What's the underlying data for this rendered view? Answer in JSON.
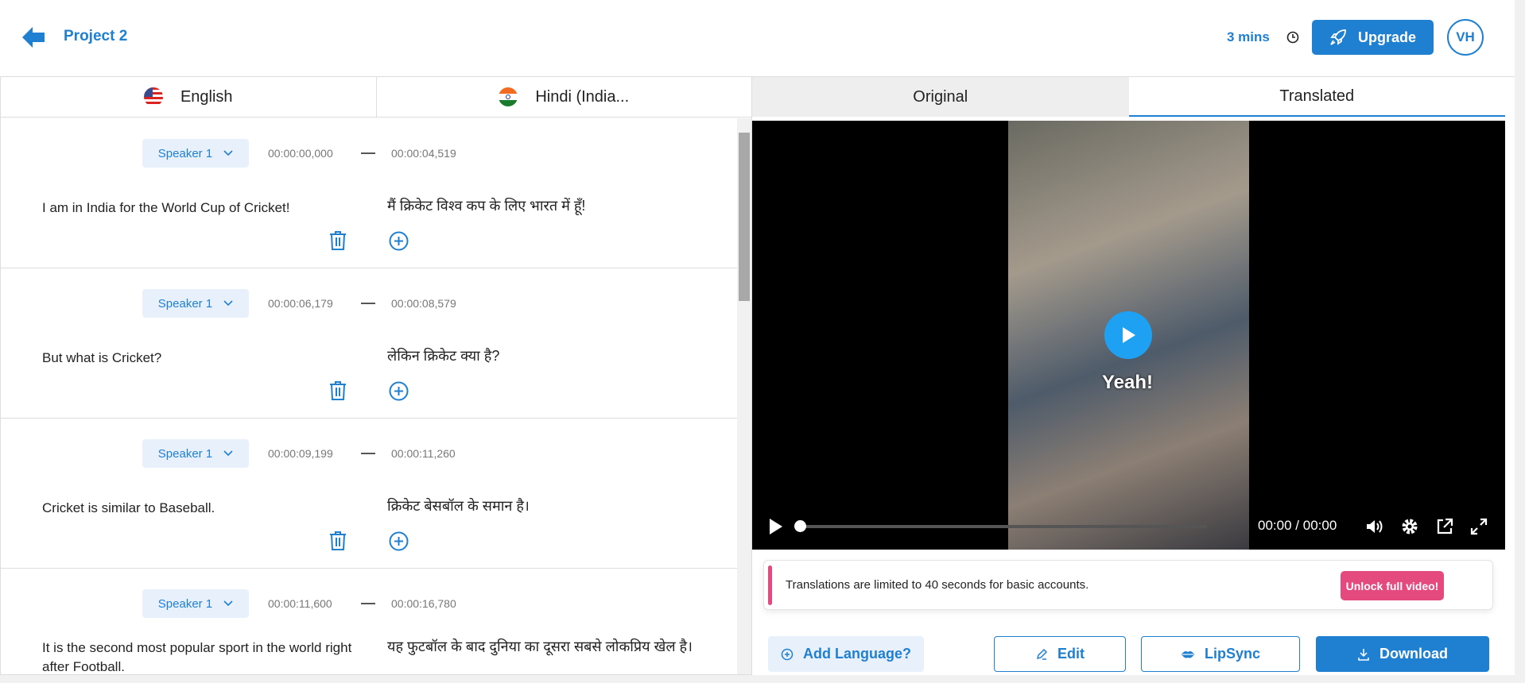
{
  "header": {
    "project_title": "Project 2",
    "minutes": "3 mins",
    "upgrade_label": "Upgrade",
    "avatar_initials": "VH"
  },
  "languages": {
    "source": "English",
    "target": "Hindi (India..."
  },
  "segments": [
    {
      "speaker": "Speaker 1",
      "start": "00:00:00,000",
      "end": "00:00:04,519",
      "english": "I am in India for the World Cup of Cricket!",
      "hindi": "मैं क्रिकेट विश्व कप के लिए भारत में हूँ!"
    },
    {
      "speaker": "Speaker 1",
      "start": "00:00:06,179",
      "end": "00:00:08,579",
      "english": "But what is Cricket?",
      "hindi": "लेकिन क्रिकेट क्या है?"
    },
    {
      "speaker": "Speaker 1",
      "start": "00:00:09,199",
      "end": "00:00:11,260",
      "english": "Cricket is similar to Baseball.",
      "hindi": "क्रिकेट बेसबॉल के समान है।"
    },
    {
      "speaker": "Speaker 1",
      "start": "00:00:11,600",
      "end": "00:00:16,780",
      "english": "It is the second most popular sport in the world right after Football.",
      "hindi": "यह फुटबॉल के बाद दुनिया का दूसरा सबसे लोकप्रिय खेल है।"
    }
  ],
  "video_tabs": {
    "original": "Original",
    "translated": "Translated"
  },
  "video": {
    "caption": "Yeah!",
    "current_time": "00:00",
    "separator": "/",
    "duration": "00:00",
    "progress": 0
  },
  "banner": {
    "message": "Translations are limited to 40 seconds for basic accounts.",
    "unlock_label": "Unlock full video!"
  },
  "actions": {
    "add_language": "Add Language?",
    "edit": "Edit",
    "lipsync": "LipSync",
    "download": "Download"
  },
  "colors": {
    "accent": "#1f7fd1",
    "pink": "#e54a7e"
  }
}
